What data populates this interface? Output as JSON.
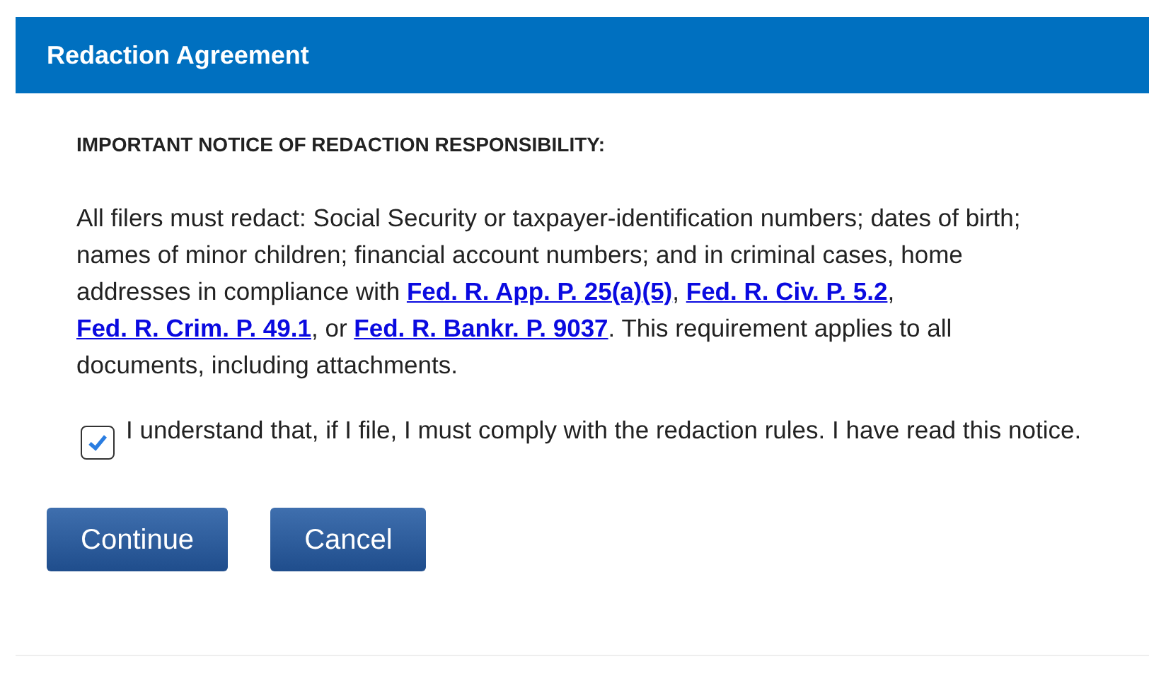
{
  "dialog": {
    "title": "Redaction Agreement"
  },
  "notice": {
    "heading": "IMPORTANT NOTICE OF REDACTION RESPONSIBILITY:",
    "paragraph": [
      {
        "kind": "text",
        "text": "All filers must redact: Social Security or taxpayer-identification numbers; dates of birth; names of minor children; financial account numbers; and in criminal cases, home addresses in compliance with "
      },
      {
        "kind": "link",
        "text": "Fed. R. App. P. 25(a)(5)"
      },
      {
        "kind": "text",
        "text": ", "
      },
      {
        "kind": "link",
        "text": "Fed. R. Civ. P. 5.2"
      },
      {
        "kind": "text",
        "text": ", "
      },
      {
        "kind": "link",
        "text": "Fed. R. Crim. P. 49.1"
      },
      {
        "kind": "text",
        "text": ", or "
      },
      {
        "kind": "link",
        "text": "Fed. R. Bankr. P. 9037"
      },
      {
        "kind": "text",
        "text": ". This requirement applies to all documents, including attachments."
      }
    ]
  },
  "agreement": {
    "label": "I understand that, if I file, I must comply with the redaction rules. I have read this notice.",
    "checked": true
  },
  "buttons": [
    "Continue",
    "Cancel"
  ]
}
